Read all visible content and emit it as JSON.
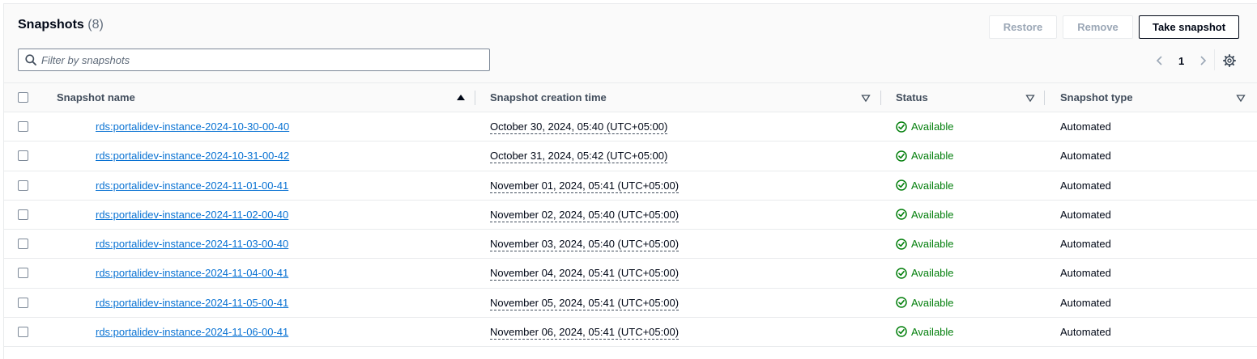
{
  "header": {
    "title": "Snapshots",
    "count": "(8)",
    "buttons": {
      "restore": "Restore",
      "remove": "Remove",
      "take_snapshot": "Take snapshot"
    }
  },
  "search": {
    "placeholder": "Filter by snapshots",
    "value": ""
  },
  "pagination": {
    "current_page": "1"
  },
  "table": {
    "columns": {
      "name": "Snapshot name",
      "creation_time": "Snapshot creation time",
      "status": "Status",
      "type": "Snapshot type"
    },
    "rows": [
      {
        "name": "rds:portalidev-instance-2024-10-30-00-40",
        "creation_time": "October 30, 2024, 05:40 (UTC+05:00)",
        "status": "Available",
        "type": "Automated"
      },
      {
        "name": "rds:portalidev-instance-2024-10-31-00-42",
        "creation_time": "October 31, 2024, 05:42 (UTC+05:00)",
        "status": "Available",
        "type": "Automated"
      },
      {
        "name": "rds:portalidev-instance-2024-11-01-00-41",
        "creation_time": "November 01, 2024, 05:41 (UTC+05:00)",
        "status": "Available",
        "type": "Automated"
      },
      {
        "name": "rds:portalidev-instance-2024-11-02-00-40",
        "creation_time": "November 02, 2024, 05:40 (UTC+05:00)",
        "status": "Available",
        "type": "Automated"
      },
      {
        "name": "rds:portalidev-instance-2024-11-03-00-40",
        "creation_time": "November 03, 2024, 05:40 (UTC+05:00)",
        "status": "Available",
        "type": "Automated"
      },
      {
        "name": "rds:portalidev-instance-2024-11-04-00-41",
        "creation_time": "November 04, 2024, 05:41 (UTC+05:00)",
        "status": "Available",
        "type": "Automated"
      },
      {
        "name": "rds:portalidev-instance-2024-11-05-00-41",
        "creation_time": "November 05, 2024, 05:41 (UTC+05:00)",
        "status": "Available",
        "type": "Automated"
      },
      {
        "name": "rds:portalidev-instance-2024-11-06-00-41",
        "creation_time": "November 06, 2024, 05:41 (UTC+05:00)",
        "status": "Available",
        "type": "Automated"
      }
    ]
  },
  "colors": {
    "link": "#0972d3",
    "available": "#037f0c",
    "border": "#e9ebed",
    "text": "#000716"
  },
  "icons": {
    "search": "search-icon",
    "prev": "chevron-left-icon",
    "next": "chevron-right-icon",
    "settings": "gear-icon",
    "sort_asc": "sort-ascending-icon",
    "sort": "sort-icon",
    "status": "check-circle-icon"
  }
}
